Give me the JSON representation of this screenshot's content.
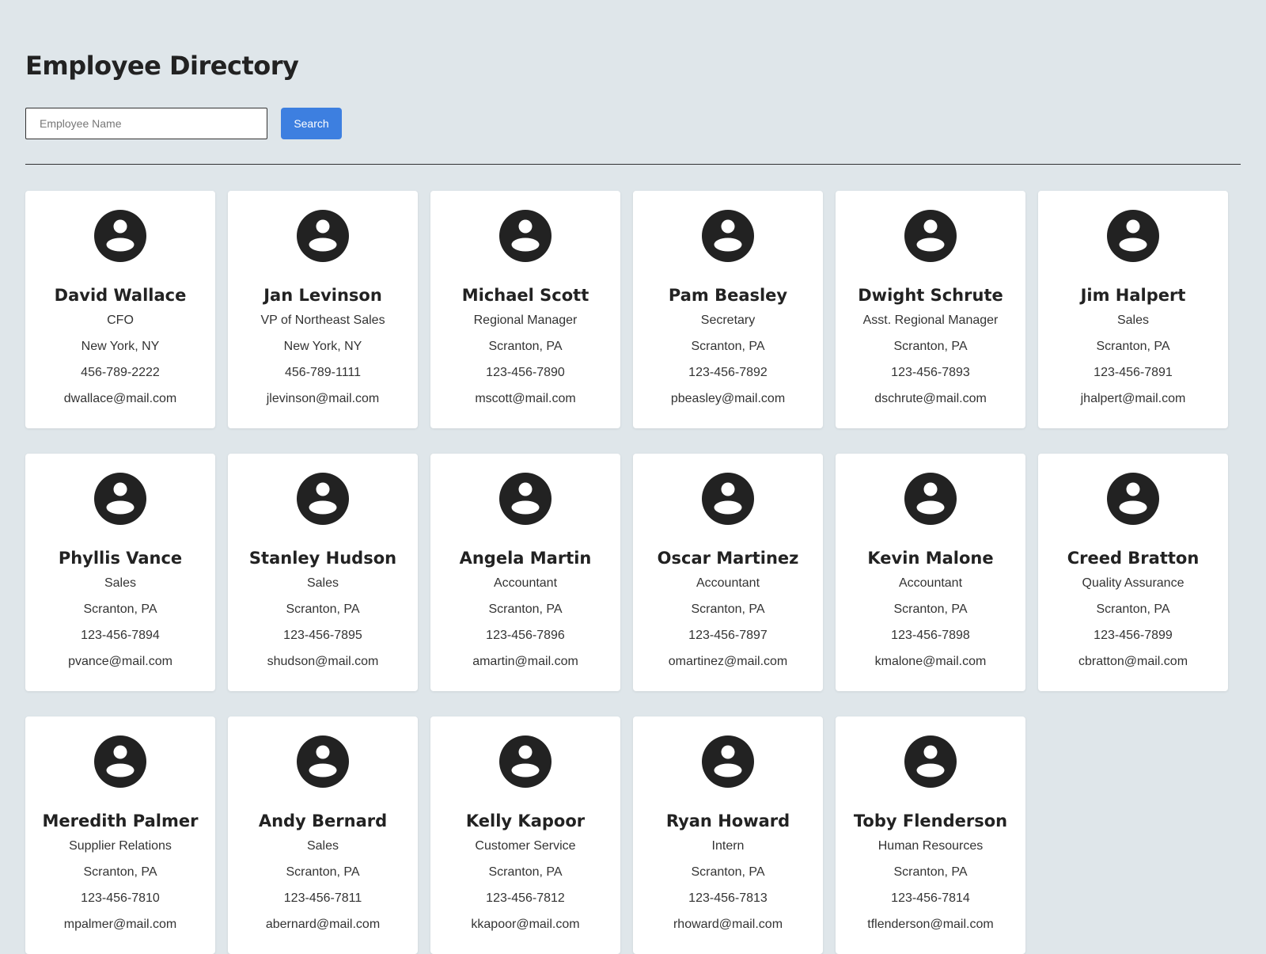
{
  "header": {
    "title": "Employee Directory"
  },
  "search": {
    "placeholder": "Employee Name",
    "value": "",
    "button_label": "Search",
    "button_color": "#3d7fe0"
  },
  "avatar_icon": "account-circle-icon",
  "employees": [
    {
      "name": "David Wallace",
      "title": "CFO",
      "location": "New York, NY",
      "phone": "456-789-2222",
      "email": "dwallace@mail.com"
    },
    {
      "name": "Jan Levinson",
      "title": "VP of Northeast Sales",
      "location": "New York, NY",
      "phone": "456-789-1111",
      "email": "jlevinson@mail.com"
    },
    {
      "name": "Michael Scott",
      "title": "Regional Manager",
      "location": "Scranton, PA",
      "phone": "123-456-7890",
      "email": "mscott@mail.com"
    },
    {
      "name": "Pam Beasley",
      "title": "Secretary",
      "location": "Scranton, PA",
      "phone": "123-456-7892",
      "email": "pbeasley@mail.com"
    },
    {
      "name": "Dwight Schrute",
      "title": "Asst. Regional Manager",
      "location": "Scranton, PA",
      "phone": "123-456-7893",
      "email": "dschrute@mail.com"
    },
    {
      "name": "Jim Halpert",
      "title": "Sales",
      "location": "Scranton, PA",
      "phone": "123-456-7891",
      "email": "jhalpert@mail.com"
    },
    {
      "name": "Phyllis Vance",
      "title": "Sales",
      "location": "Scranton, PA",
      "phone": "123-456-7894",
      "email": "pvance@mail.com"
    },
    {
      "name": "Stanley Hudson",
      "title": "Sales",
      "location": "Scranton, PA",
      "phone": "123-456-7895",
      "email": "shudson@mail.com"
    },
    {
      "name": "Angela Martin",
      "title": "Accountant",
      "location": "Scranton, PA",
      "phone": "123-456-7896",
      "email": "amartin@mail.com"
    },
    {
      "name": "Oscar Martinez",
      "title": "Accountant",
      "location": "Scranton, PA",
      "phone": "123-456-7897",
      "email": "omartinez@mail.com"
    },
    {
      "name": "Kevin Malone",
      "title": "Accountant",
      "location": "Scranton, PA",
      "phone": "123-456-7898",
      "email": "kmalone@mail.com"
    },
    {
      "name": "Creed Bratton",
      "title": "Quality Assurance",
      "location": "Scranton, PA",
      "phone": "123-456-7899",
      "email": "cbratton@mail.com"
    },
    {
      "name": "Meredith Palmer",
      "title": "Supplier Relations",
      "location": "Scranton, PA",
      "phone": "123-456-7810",
      "email": "mpalmer@mail.com"
    },
    {
      "name": "Andy Bernard",
      "title": "Sales",
      "location": "Scranton, PA",
      "phone": "123-456-7811",
      "email": "abernard@mail.com"
    },
    {
      "name": "Kelly Kapoor",
      "title": "Customer Service",
      "location": "Scranton, PA",
      "phone": "123-456-7812",
      "email": "kkapoor@mail.com"
    },
    {
      "name": "Ryan Howard",
      "title": "Intern",
      "location": "Scranton, PA",
      "phone": "123-456-7813",
      "email": "rhoward@mail.com"
    },
    {
      "name": "Toby Flenderson",
      "title": "Human Resources",
      "location": "Scranton, PA",
      "phone": "123-456-7814",
      "email": "tflenderson@mail.com"
    }
  ]
}
